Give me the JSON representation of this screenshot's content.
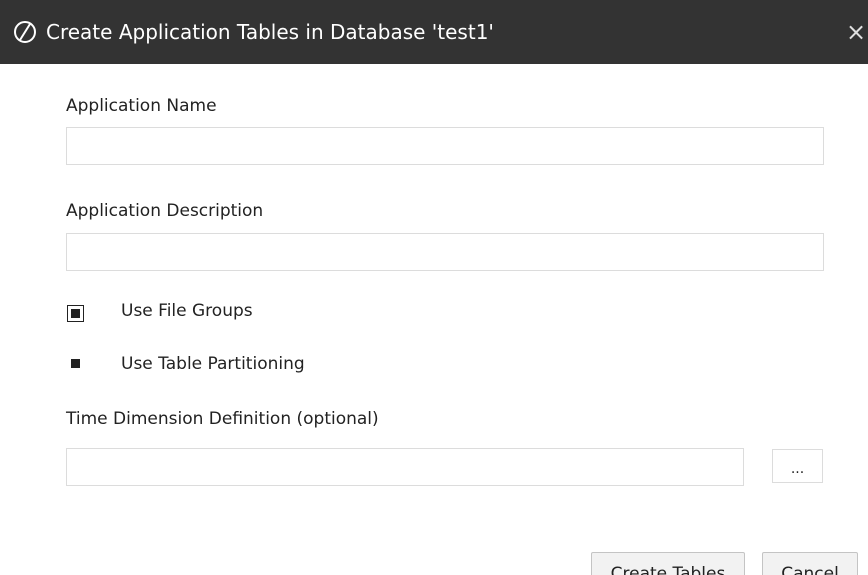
{
  "dialog": {
    "title": "Create Application Tables in Database 'test1'",
    "close_label": "×",
    "application_name": {
      "label": "Application Name",
      "value": ""
    },
    "application_description": {
      "label": "Application Description",
      "value": ""
    },
    "use_file_groups": {
      "label": "Use File Groups",
      "checked": true
    },
    "use_table_partitioning": {
      "label": "Use Table Partitioning",
      "checked": true
    },
    "time_dimension": {
      "label": "Time Dimension Definition (optional)",
      "value": "",
      "browse_label": "..."
    },
    "buttons": {
      "create_label": "Create Tables",
      "cancel_label": "Cancel"
    }
  },
  "colors": {
    "titlebar_bg": "#333333",
    "titlebar_text": "#ffffff",
    "field_border": "#dcdcdc",
    "button_bg": "#f2f2f2"
  },
  "icons": {
    "title_icon": "oracle-logo-icon",
    "close_icon": "close-icon"
  }
}
